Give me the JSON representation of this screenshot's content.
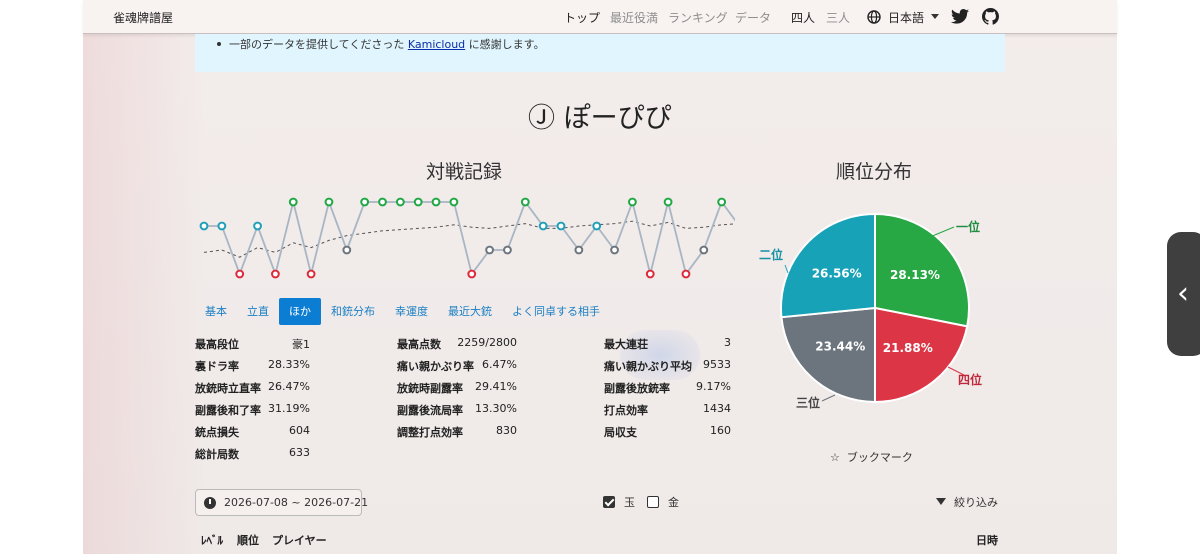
{
  "navbar": {
    "brand": "雀魂牌譜屋",
    "items": [
      "トップ",
      "最近役満",
      "ランキング",
      "データ"
    ],
    "modes": [
      "四人",
      "三人"
    ],
    "language": "日本語"
  },
  "notice": {
    "text_before": "一部のデータを提供してくださった ",
    "link_text": "Kamicloud",
    "text_after": " に感謝します。"
  },
  "player": {
    "title": "Ⓙ ぽーぴぴ"
  },
  "sections": {
    "record_title": "対戦記録",
    "rank_title": "順位分布"
  },
  "tabs": [
    "基本",
    "立直",
    "ほか",
    "和銃分布",
    "幸運度",
    "最近大銃",
    "よく同卓する相手"
  ],
  "active_tab": 2,
  "stats": [
    [
      {
        "label": "最高段位",
        "value": "豪1"
      },
      {
        "label": "裏ドラ率",
        "value": "28.33%"
      },
      {
        "label": "放銃時立直率",
        "value": "26.47%"
      },
      {
        "label": "副露後和了率",
        "value": "31.19%"
      },
      {
        "label": "銃点損失",
        "value": "604"
      },
      {
        "label": "総計局数",
        "value": "633"
      }
    ],
    [
      {
        "label": "最高点数",
        "value": "2259/2800"
      },
      {
        "label": "痛い親かぶり率",
        "value": "6.47%"
      },
      {
        "label": "放銃時副露率",
        "value": "29.41%"
      },
      {
        "label": "副露後流局率",
        "value": "13.30%"
      },
      {
        "label": "調整打点効率",
        "value": "830"
      }
    ],
    [
      {
        "label": "最大連荘",
        "value": "3"
      },
      {
        "label": "痛い親かぶり平均",
        "value": "9533"
      },
      {
        "label": "副露後放銃率",
        "value": "9.17%"
      },
      {
        "label": "打点効率",
        "value": "1434"
      },
      {
        "label": "局収支",
        "value": "160"
      }
    ]
  ],
  "bookmark": "ブックマーク",
  "date_range": "2026-07-08 ~ 2026-07-21",
  "filters": {
    "gyoku": {
      "label": "玉",
      "checked": true
    },
    "kin": {
      "label": "金",
      "checked": false
    },
    "narrow": "絞り込み"
  },
  "table_headers": [
    "ﾚﾍﾞﾙ",
    "順位",
    "プレイヤー",
    "日時"
  ],
  "chart_data": [
    {
      "type": "line",
      "title": "対戦記録",
      "y_axis": "rank (1 = top, 4 = bottom), axis inverted",
      "series": [
        {
          "values": [
            2,
            2,
            4,
            2,
            4,
            1,
            4,
            1,
            3,
            1,
            1,
            1,
            1,
            1,
            1,
            4,
            3,
            3,
            1,
            2,
            2,
            3,
            2,
            3,
            1,
            4,
            1,
            4,
            3,
            1,
            2
          ],
          "style": "solid"
        },
        {
          "values": [
            3.1,
            3.0,
            3.3,
            2.9,
            3.1,
            2.7,
            2.9,
            2.6,
            2.4,
            2.3,
            2.2,
            2.15,
            2.1,
            2.05,
            1.95,
            2.05,
            2.1,
            2.0,
            1.9,
            2.1,
            2.1,
            2.0,
            1.95,
            1.9,
            1.8,
            2.0,
            1.85,
            2.1,
            2.05,
            1.95,
            1.9
          ],
          "style": "dashed"
        }
      ],
      "rank_colors": {
        "1": "#20a845",
        "2": "#1fa0b6",
        "3": "#6c757d",
        "4": "#dc2b3c"
      },
      "line_color": "#a8b6c4"
    },
    {
      "type": "pie",
      "title": "順位分布",
      "categories": [
        "一位",
        "四位",
        "三位",
        "二位"
      ],
      "values": [
        28.13,
        21.88,
        23.44,
        26.56
      ],
      "labels": [
        "28.13%",
        "21.88%",
        "23.44%",
        "26.56%"
      ],
      "colors": [
        "#28a745",
        "#dc3545",
        "#6c757d",
        "#17a2b8"
      ]
    }
  ]
}
